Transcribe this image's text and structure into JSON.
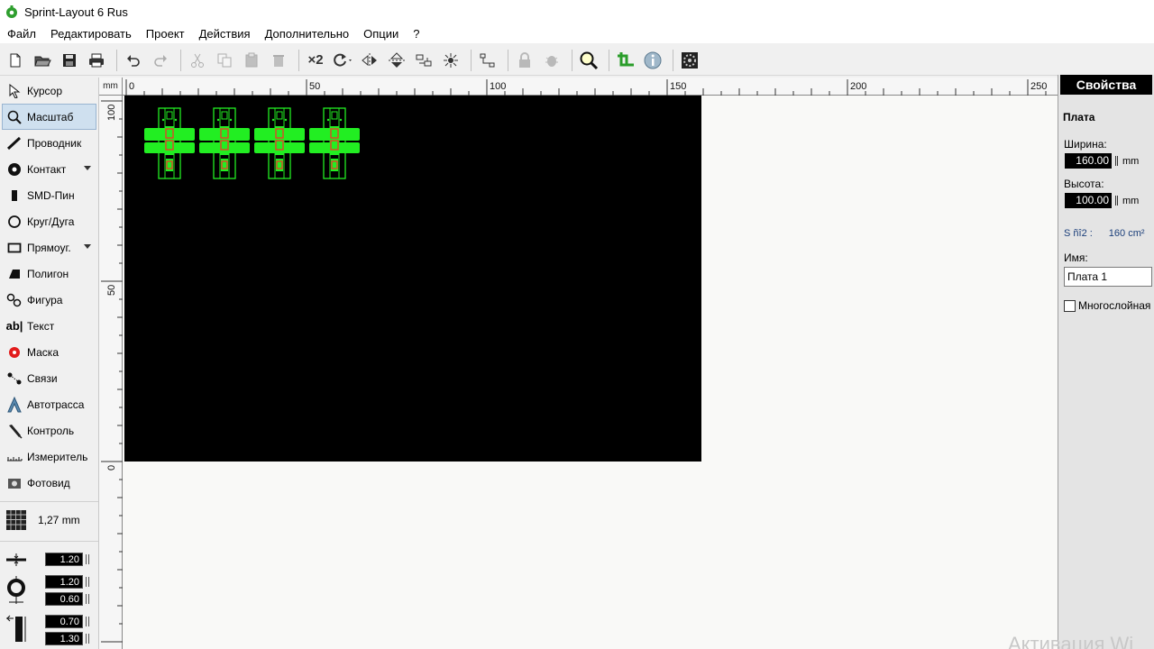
{
  "window": {
    "title": "Sprint-Layout 6 Rus"
  },
  "menu": [
    "Файл",
    "Редактировать",
    "Проект",
    "Действия",
    "Дополнительно",
    "Опции",
    "?"
  ],
  "toolbar": {
    "mult_label": "×2"
  },
  "tools": [
    {
      "label": "Курсор",
      "icon": "cursor-icon"
    },
    {
      "label": "Масштаб",
      "icon": "zoom-icon",
      "active": true
    },
    {
      "label": "Проводник",
      "icon": "track-icon"
    },
    {
      "label": "Контакт",
      "icon": "pad-icon",
      "dropdown": true
    },
    {
      "label": "SMD-Пин",
      "icon": "smd-pad-icon"
    },
    {
      "label": "Круг/Дуга",
      "icon": "circle-icon"
    },
    {
      "label": "Прямоуг.",
      "icon": "rectangle-icon",
      "dropdown": true
    },
    {
      "label": "Полигон",
      "icon": "polygon-icon"
    },
    {
      "label": "Фигура",
      "icon": "shape-icon"
    },
    {
      "label": "Текст",
      "icon": "text-icon"
    },
    {
      "label": "Маска",
      "icon": "mask-icon"
    },
    {
      "label": "Связи",
      "icon": "connections-icon"
    },
    {
      "label": "Автотрасса",
      "icon": "autoroute-icon"
    },
    {
      "label": "Контроль",
      "icon": "check-icon"
    },
    {
      "label": "Измеритель",
      "icon": "measure-icon"
    },
    {
      "label": "Фотовид",
      "icon": "photoview-icon"
    }
  ],
  "grid": {
    "value": "1,27 mm"
  },
  "params": {
    "track_width": "1.20",
    "pad_outer": "1.20",
    "pad_inner": "0.60",
    "smd_x": "0.70",
    "smd_y": "1.30"
  },
  "ruler": {
    "unit": "mm",
    "top_labels": [
      "0",
      "50",
      "100",
      "150",
      "200",
      "250"
    ],
    "left_labels": [
      "100",
      "50",
      "0"
    ]
  },
  "properties": {
    "header": "Свойства",
    "section": "Плата",
    "width_label": "Ширина:",
    "width_value": "160.00",
    "height_label": "Высота:",
    "height_value": "100.00",
    "unit": "mm",
    "area_label": "S ñî2 :",
    "area_value": "160 cm²",
    "name_label": "Имя:",
    "name_value": "Плата 1",
    "multilayer_label": "Многослойная"
  },
  "watermark": "Активация Wi"
}
